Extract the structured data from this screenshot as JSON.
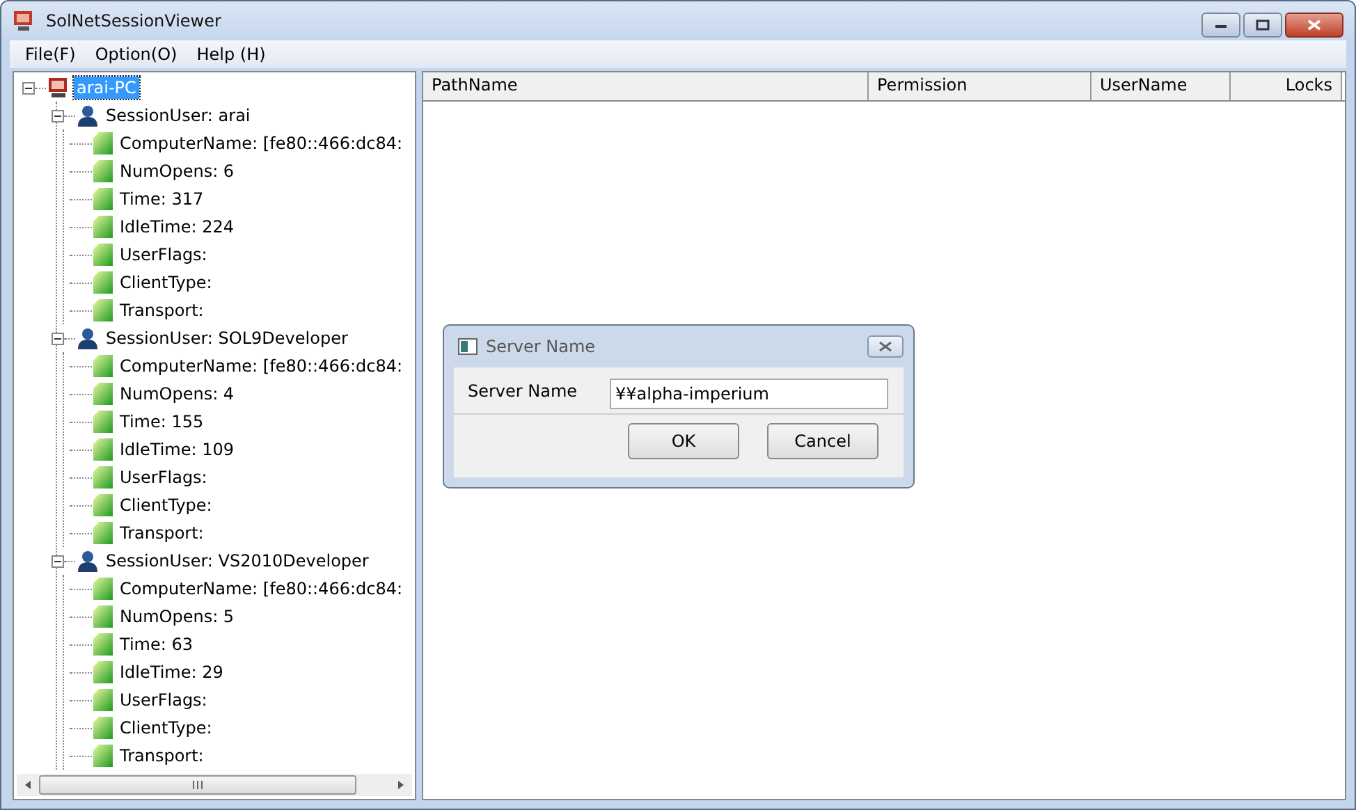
{
  "window": {
    "title": "SolNetSessionViewer"
  },
  "menu": [
    {
      "label": "File(F)"
    },
    {
      "label": "Option(O)"
    },
    {
      "label": "Help (H)"
    }
  ],
  "tree": {
    "nodes": [
      {
        "label": "arai-PC",
        "kind": "computer",
        "expanded": true,
        "selected": true,
        "children": [
          {
            "label": "SessionUser: arai",
            "kind": "user",
            "expanded": true,
            "selected": false,
            "children": [
              {
                "label": "ComputerName: [fe80::466:dc84:",
                "kind": "property",
                "selected": false
              },
              {
                "label": "NumOpens: 6",
                "kind": "property",
                "selected": false
              },
              {
                "label": "Time: 317",
                "kind": "property",
                "selected": false
              },
              {
                "label": "IdleTime: 224",
                "kind": "property",
                "selected": false
              },
              {
                "label": "UserFlags:",
                "kind": "property",
                "selected": false
              },
              {
                "label": "ClientType:",
                "kind": "property",
                "selected": false
              },
              {
                "label": "Transport:",
                "kind": "property",
                "selected": false
              }
            ]
          },
          {
            "label": "SessionUser: SOL9Developer",
            "kind": "user",
            "expanded": true,
            "selected": false,
            "children": [
              {
                "label": "ComputerName: [fe80::466:dc84:",
                "kind": "property",
                "selected": false
              },
              {
                "label": "NumOpens: 4",
                "kind": "property",
                "selected": false
              },
              {
                "label": "Time: 155",
                "kind": "property",
                "selected": false
              },
              {
                "label": "IdleTime: 109",
                "kind": "property",
                "selected": false
              },
              {
                "label": "UserFlags:",
                "kind": "property",
                "selected": false
              },
              {
                "label": "ClientType:",
                "kind": "property",
                "selected": false
              },
              {
                "label": "Transport:",
                "kind": "property",
                "selected": false
              }
            ]
          },
          {
            "label": "SessionUser: VS2010Developer",
            "kind": "user",
            "expanded": true,
            "selected": false,
            "children": [
              {
                "label": "ComputerName: [fe80::466:dc84:",
                "kind": "property",
                "selected": false
              },
              {
                "label": "NumOpens: 5",
                "kind": "property",
                "selected": false
              },
              {
                "label": "Time: 63",
                "kind": "property",
                "selected": false
              },
              {
                "label": "IdleTime: 29",
                "kind": "property",
                "selected": false
              },
              {
                "label": "UserFlags:",
                "kind": "property",
                "selected": false
              },
              {
                "label": "ClientType:",
                "kind": "property",
                "selected": false
              },
              {
                "label": "Transport:",
                "kind": "property",
                "selected": false
              }
            ]
          }
        ]
      }
    ]
  },
  "list": {
    "columns": [
      {
        "label": "PathName"
      },
      {
        "label": "Permission"
      },
      {
        "label": "UserName"
      },
      {
        "label": "Locks"
      }
    ]
  },
  "dialog": {
    "title": "Server Name",
    "field_label": "Server Name",
    "value": "¥¥alpha-imperium",
    "buttons": [
      {
        "label": "OK"
      },
      {
        "label": "Cancel"
      }
    ]
  }
}
